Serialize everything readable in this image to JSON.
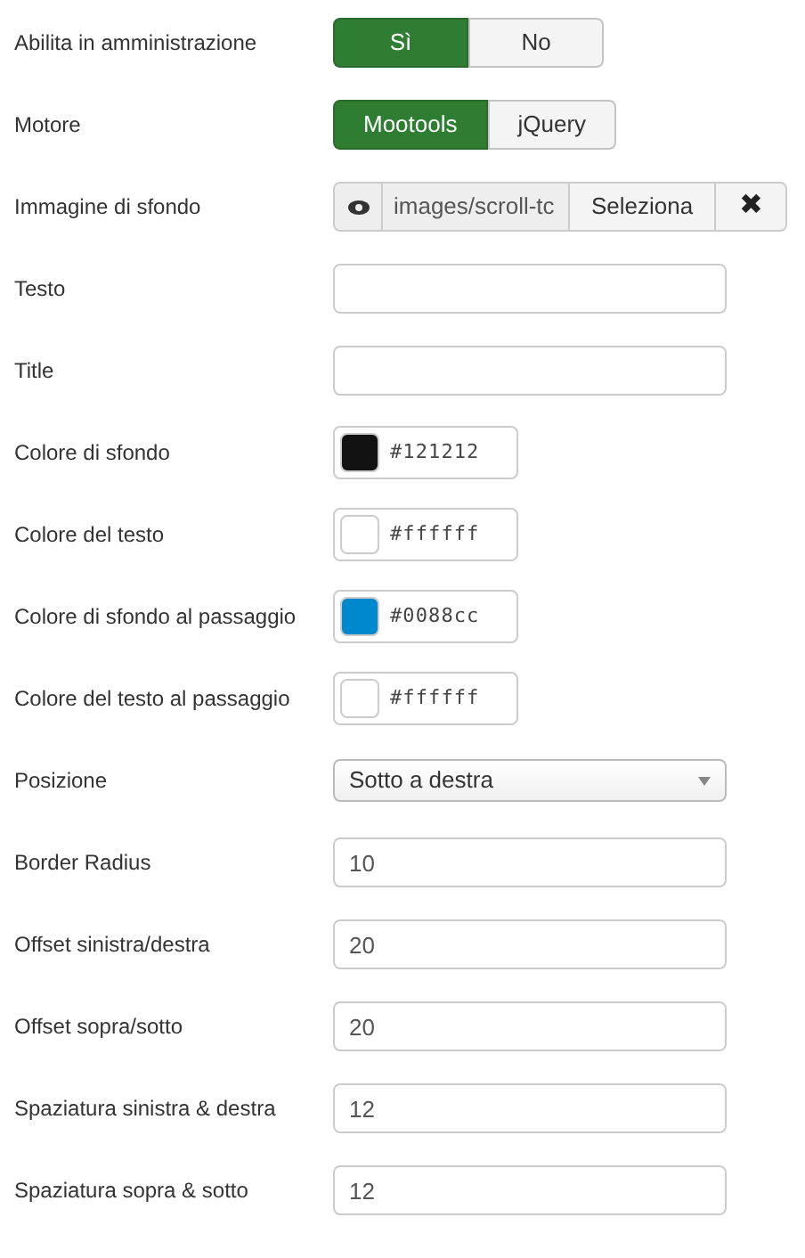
{
  "fields": [
    {
      "kind": "toggle",
      "label": "Abilita in amministrazione",
      "options": [
        {
          "label": "Sì",
          "selected": true
        },
        {
          "label": "No",
          "selected": false
        }
      ]
    },
    {
      "kind": "toggle",
      "label": "Motore",
      "options": [
        {
          "label": "Mootools",
          "selected": true
        },
        {
          "label": "jQuery",
          "selected": false
        }
      ]
    },
    {
      "kind": "image",
      "label": "Immagine di sfondo",
      "value": "images/scroll-tc",
      "button": "Seleziona",
      "clear": "✖"
    },
    {
      "kind": "text",
      "label": "Testo"
    },
    {
      "kind": "text",
      "label": "Title"
    },
    {
      "kind": "color",
      "label": "Colore di sfondo",
      "value": "#121212",
      "color": "#121212"
    },
    {
      "kind": "color",
      "label": "Colore del testo",
      "value": "#ffffff",
      "color": "#ffffff"
    },
    {
      "kind": "color",
      "label": "Colore di sfondo al passaggio",
      "value": "#0088cc",
      "color": "#0088cc"
    },
    {
      "kind": "color",
      "label": "Colore del testo al passaggio",
      "value": "#ffffff",
      "color": "#ffffff"
    },
    {
      "kind": "select",
      "label": "Posizione",
      "value": "Sotto a destra"
    },
    {
      "kind": "text",
      "label": "Border Radius",
      "value": "10"
    },
    {
      "kind": "text",
      "label": "Offset sinistra/destra",
      "value": "20"
    },
    {
      "kind": "text",
      "label": "Offset sopra/sotto",
      "value": "20"
    },
    {
      "kind": "text",
      "label": "Spaziatura sinistra & destra",
      "value": "12"
    },
    {
      "kind": "text",
      "label": "Spaziatura sopra & sotto",
      "value": "12"
    }
  ]
}
